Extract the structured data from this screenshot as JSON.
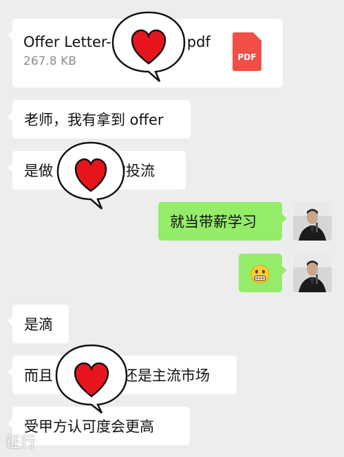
{
  "chat": {
    "file": {
      "name": "Offer Letter-",
      "ext": "pdf",
      "size": "267.8 KB",
      "type_label": "PDF"
    },
    "messages": [
      {
        "side": "left",
        "text": "老师，我有拿到 offer"
      },
      {
        "side": "left",
        "text_before": "是做",
        "text_after": "的投流"
      },
      {
        "side": "right",
        "text": "就当带薪学习"
      },
      {
        "side": "right",
        "emoji": "grimacing-face-icon"
      },
      {
        "side": "left",
        "text": "是滴"
      },
      {
        "side": "left",
        "text_before": "而且",
        "text_after": "还是主流市场"
      },
      {
        "side": "left",
        "text": "受甲方认可度会更高"
      }
    ]
  },
  "watermark": "征行",
  "colors": {
    "background": "#ededed",
    "incoming": "#ffffff",
    "outgoing": "#95ec69",
    "pdf": "#f04e46",
    "heart": "#e8141d"
  }
}
